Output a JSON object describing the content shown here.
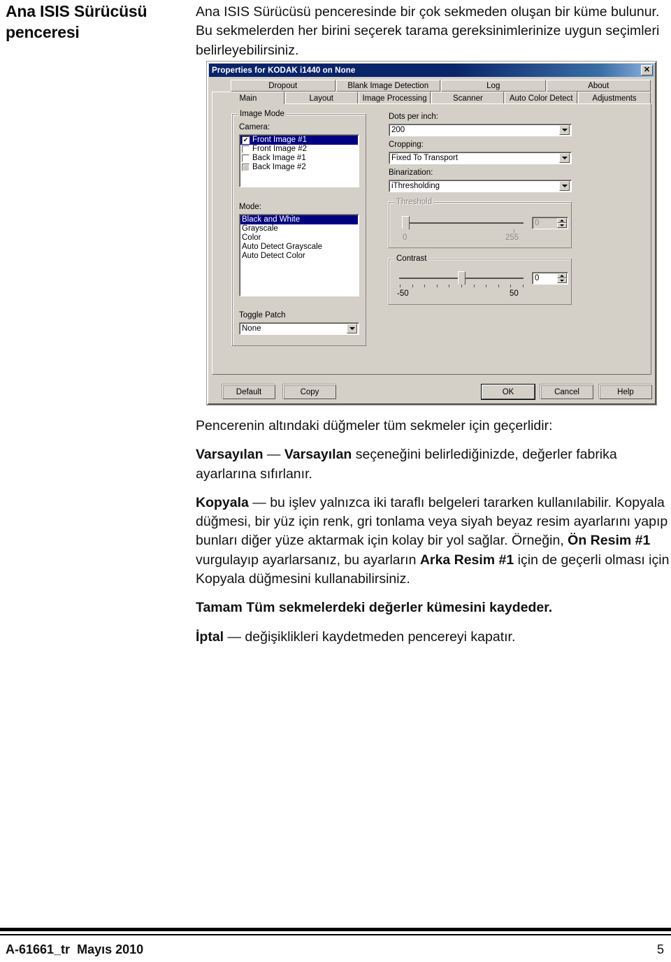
{
  "heading": "Ana ISIS Sürücüsü penceresi",
  "intro": "Ana ISIS Sürücüsü penceresinde bir çok sekmeden oluşan bir küme bulunur. Bu sekmelerden her birini seçerek tarama gereksinimlerinize uygun seçimleri belirleyebilirsiniz.",
  "dialog": {
    "title": "Properties for KODAK i1440 on None",
    "close_label": "✕",
    "tabs_row1": [
      "Dropout",
      "Blank Image Detection",
      "Log",
      "About"
    ],
    "tabs_row2": [
      "Main",
      "Layout",
      "Image Processing",
      "Scanner",
      "Auto Color Detect",
      "Adjustments"
    ],
    "active_tab": "Main",
    "image_mode": {
      "group_label": "Image Mode",
      "camera_label": "Camera:",
      "camera_items": [
        {
          "label": "Front Image #1",
          "checked": true,
          "selected": true,
          "disabled": false
        },
        {
          "label": "Front Image #2",
          "checked": false,
          "selected": false,
          "disabled": false
        },
        {
          "label": "Back Image #1",
          "checked": false,
          "selected": false,
          "disabled": false
        },
        {
          "label": "Back Image #2",
          "checked": false,
          "selected": false,
          "disabled": true
        }
      ],
      "mode_label": "Mode:",
      "mode_items": [
        {
          "label": "Black and White",
          "selected": true
        },
        {
          "label": "Grayscale",
          "selected": false
        },
        {
          "label": "Color",
          "selected": false
        },
        {
          "label": "Auto Detect Grayscale",
          "selected": false
        },
        {
          "label": "Auto Detect Color",
          "selected": false
        }
      ],
      "toggle_patch_label": "Toggle Patch",
      "toggle_patch_value": "None"
    },
    "right_panel": {
      "dpi_label": "Dots per inch:",
      "dpi_value": "200",
      "cropping_label": "Cropping:",
      "cropping_value": "Fixed To Transport",
      "binarization_label": "Binarization:",
      "binarization_value": "iThresholding",
      "threshold": {
        "group_label": "Threshold",
        "value": "0",
        "min_label": "0",
        "max_label": "255",
        "disabled": true
      },
      "contrast": {
        "group_label": "Contrast",
        "value": "0",
        "min_label": "-50",
        "max_label": "50",
        "disabled": false
      }
    },
    "buttons": {
      "default": "Default",
      "copy": "Copy",
      "ok": "OK",
      "cancel": "Cancel",
      "help": "Help"
    }
  },
  "body": {
    "p1": "Pencerenin altındaki düğmeler tüm sekmeler için geçerlidir:",
    "p2_bold_a": "Varsayılan",
    "p2_dash": " — ",
    "p2_bold_b": "Varsayılan",
    "p2_rest": " seçeneğini belirlediğinizde, değerler fabrika ayarlarına sıfırlanır.",
    "p3_bold": "Kopyala",
    "p3_rest": " — bu işlev yalnızca iki taraflı belgeleri tararken kullanılabilir. Kopyala düğmesi, bir yüz için renk, gri tonlama veya siyah beyaz resim ayarlarını yapıp bunları diğer yüze aktarmak için kolay bir yol sağlar. Örneğin, ",
    "p3_bold2": "Ön Resim #1",
    "p3_rest2": " vurgulayıp ayarlarsanız, bu ayarların ",
    "p3_bold3": "Arka Resim #1",
    "p3_rest3": " için de geçerli olması için Kopyala düğmesini kullanabilirsiniz.",
    "p4": "Tamam Tüm sekmelerdeki değerler kümesini kaydeder.",
    "p5_bold": "İptal",
    "p5_rest": " — değişiklikleri kaydetmeden pencereyi kapatır."
  },
  "footer": {
    "doc_id": "A-61661_tr",
    "date": "Mayıs 2010",
    "page_number": "5"
  }
}
